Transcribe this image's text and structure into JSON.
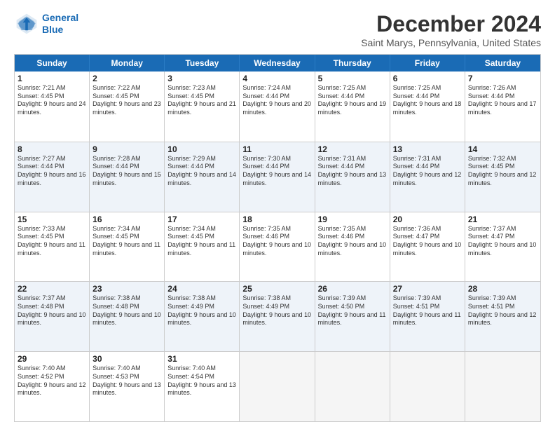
{
  "logo": {
    "line1": "General",
    "line2": "Blue"
  },
  "title": "December 2024",
  "location": "Saint Marys, Pennsylvania, United States",
  "days_of_week": [
    "Sunday",
    "Monday",
    "Tuesday",
    "Wednesday",
    "Thursday",
    "Friday",
    "Saturday"
  ],
  "weeks": [
    [
      {
        "day": "1",
        "sunrise": "Sunrise: 7:21 AM",
        "sunset": "Sunset: 4:45 PM",
        "daylight": "Daylight: 9 hours and 24 minutes."
      },
      {
        "day": "2",
        "sunrise": "Sunrise: 7:22 AM",
        "sunset": "Sunset: 4:45 PM",
        "daylight": "Daylight: 9 hours and 23 minutes."
      },
      {
        "day": "3",
        "sunrise": "Sunrise: 7:23 AM",
        "sunset": "Sunset: 4:45 PM",
        "daylight": "Daylight: 9 hours and 21 minutes."
      },
      {
        "day": "4",
        "sunrise": "Sunrise: 7:24 AM",
        "sunset": "Sunset: 4:44 PM",
        "daylight": "Daylight: 9 hours and 20 minutes."
      },
      {
        "day": "5",
        "sunrise": "Sunrise: 7:25 AM",
        "sunset": "Sunset: 4:44 PM",
        "daylight": "Daylight: 9 hours and 19 minutes."
      },
      {
        "day": "6",
        "sunrise": "Sunrise: 7:25 AM",
        "sunset": "Sunset: 4:44 PM",
        "daylight": "Daylight: 9 hours and 18 minutes."
      },
      {
        "day": "7",
        "sunrise": "Sunrise: 7:26 AM",
        "sunset": "Sunset: 4:44 PM",
        "daylight": "Daylight: 9 hours and 17 minutes."
      }
    ],
    [
      {
        "day": "8",
        "sunrise": "Sunrise: 7:27 AM",
        "sunset": "Sunset: 4:44 PM",
        "daylight": "Daylight: 9 hours and 16 minutes."
      },
      {
        "day": "9",
        "sunrise": "Sunrise: 7:28 AM",
        "sunset": "Sunset: 4:44 PM",
        "daylight": "Daylight: 9 hours and 15 minutes."
      },
      {
        "day": "10",
        "sunrise": "Sunrise: 7:29 AM",
        "sunset": "Sunset: 4:44 PM",
        "daylight": "Daylight: 9 hours and 14 minutes."
      },
      {
        "day": "11",
        "sunrise": "Sunrise: 7:30 AM",
        "sunset": "Sunset: 4:44 PM",
        "daylight": "Daylight: 9 hours and 14 minutes."
      },
      {
        "day": "12",
        "sunrise": "Sunrise: 7:31 AM",
        "sunset": "Sunset: 4:44 PM",
        "daylight": "Daylight: 9 hours and 13 minutes."
      },
      {
        "day": "13",
        "sunrise": "Sunrise: 7:31 AM",
        "sunset": "Sunset: 4:44 PM",
        "daylight": "Daylight: 9 hours and 12 minutes."
      },
      {
        "day": "14",
        "sunrise": "Sunrise: 7:32 AM",
        "sunset": "Sunset: 4:45 PM",
        "daylight": "Daylight: 9 hours and 12 minutes."
      }
    ],
    [
      {
        "day": "15",
        "sunrise": "Sunrise: 7:33 AM",
        "sunset": "Sunset: 4:45 PM",
        "daylight": "Daylight: 9 hours and 11 minutes."
      },
      {
        "day": "16",
        "sunrise": "Sunrise: 7:34 AM",
        "sunset": "Sunset: 4:45 PM",
        "daylight": "Daylight: 9 hours and 11 minutes."
      },
      {
        "day": "17",
        "sunrise": "Sunrise: 7:34 AM",
        "sunset": "Sunset: 4:45 PM",
        "daylight": "Daylight: 9 hours and 11 minutes."
      },
      {
        "day": "18",
        "sunrise": "Sunrise: 7:35 AM",
        "sunset": "Sunset: 4:46 PM",
        "daylight": "Daylight: 9 hours and 10 minutes."
      },
      {
        "day": "19",
        "sunrise": "Sunrise: 7:35 AM",
        "sunset": "Sunset: 4:46 PM",
        "daylight": "Daylight: 9 hours and 10 minutes."
      },
      {
        "day": "20",
        "sunrise": "Sunrise: 7:36 AM",
        "sunset": "Sunset: 4:47 PM",
        "daylight": "Daylight: 9 hours and 10 minutes."
      },
      {
        "day": "21",
        "sunrise": "Sunrise: 7:37 AM",
        "sunset": "Sunset: 4:47 PM",
        "daylight": "Daylight: 9 hours and 10 minutes."
      }
    ],
    [
      {
        "day": "22",
        "sunrise": "Sunrise: 7:37 AM",
        "sunset": "Sunset: 4:48 PM",
        "daylight": "Daylight: 9 hours and 10 minutes."
      },
      {
        "day": "23",
        "sunrise": "Sunrise: 7:38 AM",
        "sunset": "Sunset: 4:48 PM",
        "daylight": "Daylight: 9 hours and 10 minutes."
      },
      {
        "day": "24",
        "sunrise": "Sunrise: 7:38 AM",
        "sunset": "Sunset: 4:49 PM",
        "daylight": "Daylight: 9 hours and 10 minutes."
      },
      {
        "day": "25",
        "sunrise": "Sunrise: 7:38 AM",
        "sunset": "Sunset: 4:49 PM",
        "daylight": "Daylight: 9 hours and 10 minutes."
      },
      {
        "day": "26",
        "sunrise": "Sunrise: 7:39 AM",
        "sunset": "Sunset: 4:50 PM",
        "daylight": "Daylight: 9 hours and 11 minutes."
      },
      {
        "day": "27",
        "sunrise": "Sunrise: 7:39 AM",
        "sunset": "Sunset: 4:51 PM",
        "daylight": "Daylight: 9 hours and 11 minutes."
      },
      {
        "day": "28",
        "sunrise": "Sunrise: 7:39 AM",
        "sunset": "Sunset: 4:51 PM",
        "daylight": "Daylight: 9 hours and 12 minutes."
      }
    ],
    [
      {
        "day": "29",
        "sunrise": "Sunrise: 7:40 AM",
        "sunset": "Sunset: 4:52 PM",
        "daylight": "Daylight: 9 hours and 12 minutes."
      },
      {
        "day": "30",
        "sunrise": "Sunrise: 7:40 AM",
        "sunset": "Sunset: 4:53 PM",
        "daylight": "Daylight: 9 hours and 13 minutes."
      },
      {
        "day": "31",
        "sunrise": "Sunrise: 7:40 AM",
        "sunset": "Sunset: 4:54 PM",
        "daylight": "Daylight: 9 hours and 13 minutes."
      },
      null,
      null,
      null,
      null
    ]
  ]
}
